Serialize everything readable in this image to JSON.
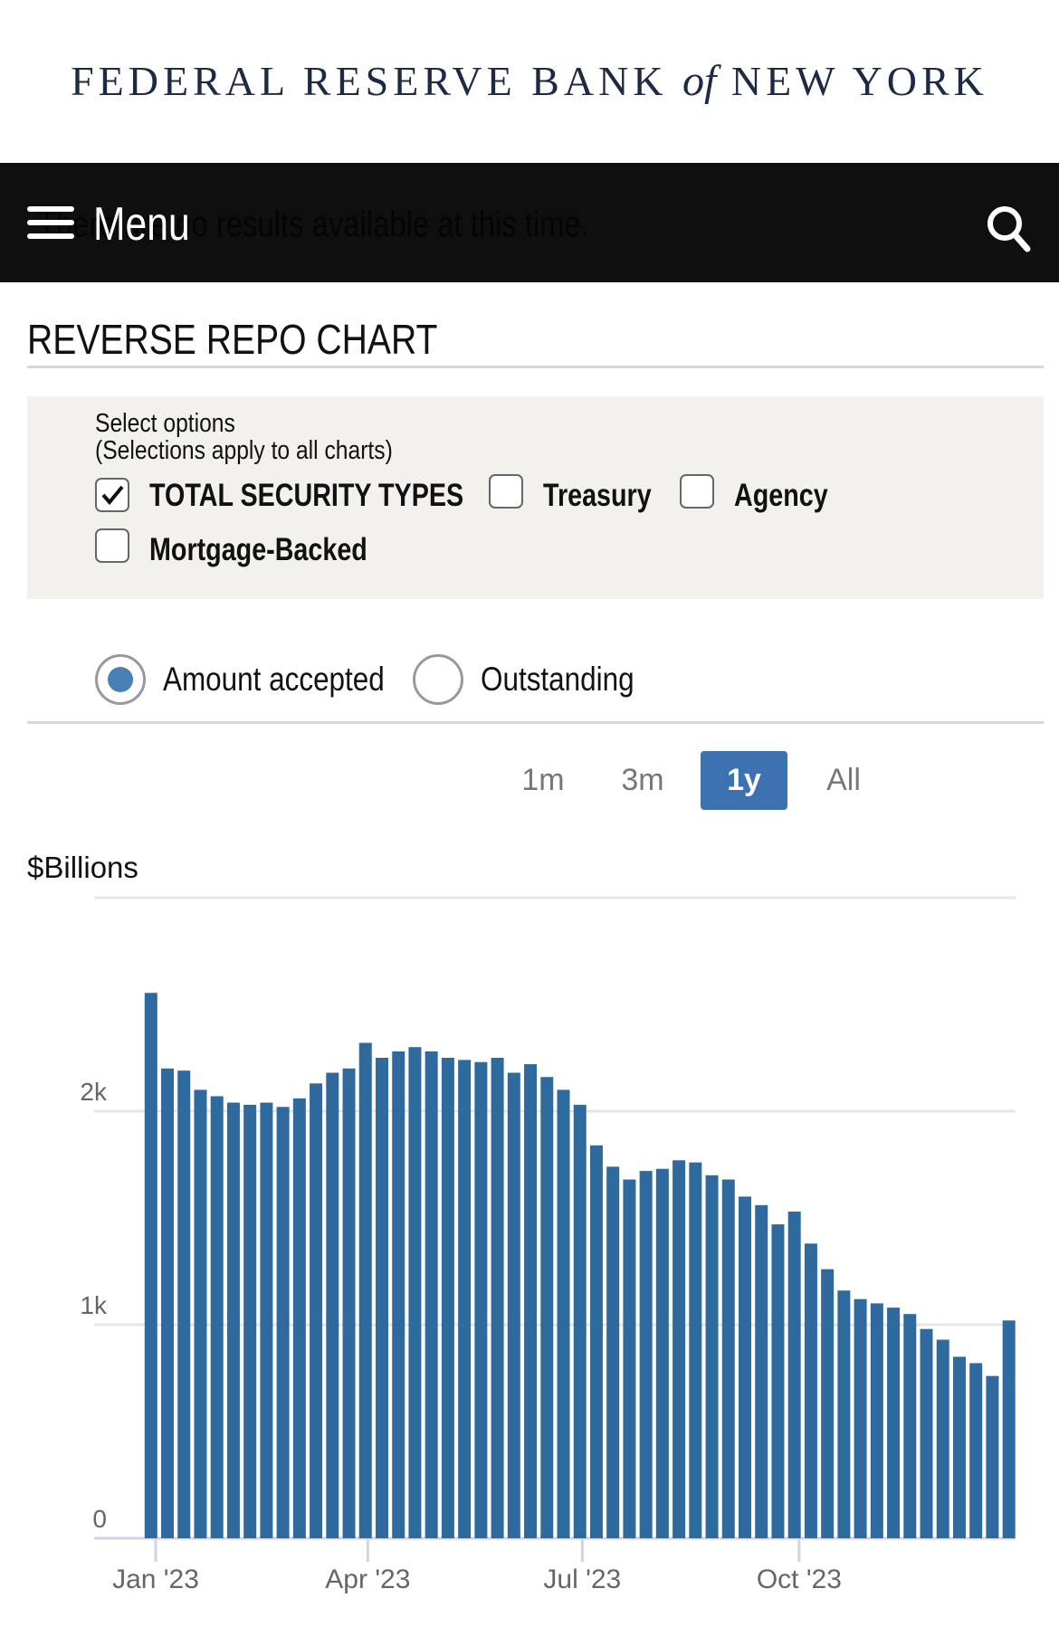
{
  "header": {
    "logo_text": "FEDERAL RESERVE BANK of NEW YORK",
    "logo_pre": "FEDERAL RESERVE BANK ",
    "logo_of": "of",
    "logo_post": " NEW YORK"
  },
  "nav": {
    "menu_label": "Menu",
    "ghost_text": "There are no results available at this time.",
    "icons": [
      "hamburger-icon",
      "search-icon"
    ]
  },
  "page": {
    "title": "REVERSE REPO CHART"
  },
  "options": {
    "heading": "Select options",
    "subheading": "(Selections apply to all charts)",
    "checkboxes": [
      {
        "label": "TOTAL SECURITY TYPES",
        "checked": true
      },
      {
        "label": "Treasury",
        "checked": false
      },
      {
        "label": "Agency",
        "checked": false
      },
      {
        "label": "Mortgage-Backed",
        "checked": false
      }
    ],
    "radios": [
      {
        "label": "Amount accepted",
        "selected": true
      },
      {
        "label": "Outstanding",
        "selected": false
      }
    ]
  },
  "ranges": [
    {
      "label": "1m",
      "active": false
    },
    {
      "label": "3m",
      "active": false
    },
    {
      "label": "1y",
      "active": true
    },
    {
      "label": "All",
      "active": false
    }
  ],
  "colors": {
    "bar": "#2f6a9e",
    "accent": "#3d72b0",
    "nav": "#0f0f0f",
    "options_bg": "#f2f1ee"
  },
  "chart_data": {
    "type": "bar",
    "ylabel": "$Billions",
    "ylim": [
      0,
      3000
    ],
    "yticks": [
      {
        "value": 0,
        "label": "0"
      },
      {
        "value": 1000,
        "label": "1k"
      },
      {
        "value": 2000,
        "label": "2k"
      },
      {
        "value": 3000,
        "label": ""
      }
    ],
    "xticks": [
      {
        "date": "2023-01-01",
        "label": "Jan '23"
      },
      {
        "date": "2023-04-01",
        "label": "Apr '23"
      },
      {
        "date": "2023-07-01",
        "label": "Jul '23"
      },
      {
        "date": "2023-10-01",
        "label": "Oct '23"
      }
    ],
    "grid": true,
    "x": [
      "2022-12-30",
      "2023-01-06",
      "2023-01-13",
      "2023-01-20",
      "2023-01-27",
      "2023-02-03",
      "2023-02-10",
      "2023-02-17",
      "2023-02-24",
      "2023-03-03",
      "2023-03-10",
      "2023-03-17",
      "2023-03-24",
      "2023-03-31",
      "2023-04-07",
      "2023-04-14",
      "2023-04-21",
      "2023-04-28",
      "2023-05-05",
      "2023-05-12",
      "2023-05-19",
      "2023-05-26",
      "2023-06-02",
      "2023-06-09",
      "2023-06-16",
      "2023-06-23",
      "2023-06-30",
      "2023-07-07",
      "2023-07-14",
      "2023-07-21",
      "2023-07-28",
      "2023-08-04",
      "2023-08-11",
      "2023-08-18",
      "2023-08-25",
      "2023-09-01",
      "2023-09-08",
      "2023-09-15",
      "2023-09-22",
      "2023-09-29",
      "2023-10-06",
      "2023-10-13",
      "2023-10-20",
      "2023-10-27",
      "2023-11-03",
      "2023-11-10",
      "2023-11-17",
      "2023-11-24",
      "2023-12-01",
      "2023-12-08",
      "2023-12-15",
      "2023-12-22",
      "2023-12-29"
    ],
    "values": [
      2554,
      2200,
      2190,
      2100,
      2070,
      2040,
      2030,
      2040,
      2020,
      2060,
      2130,
      2180,
      2200,
      2320,
      2250,
      2280,
      2300,
      2280,
      2250,
      2240,
      2230,
      2250,
      2180,
      2220,
      2160,
      2100,
      2030,
      1840,
      1740,
      1680,
      1720,
      1730,
      1770,
      1760,
      1700,
      1680,
      1600,
      1560,
      1470,
      1530,
      1380,
      1260,
      1160,
      1120,
      1100,
      1080,
      1050,
      980,
      930,
      850,
      820,
      760,
      1020
    ]
  }
}
